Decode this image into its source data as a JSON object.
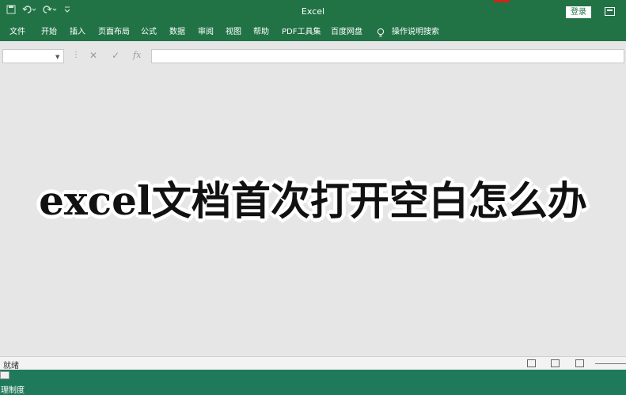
{
  "window": {
    "title": "Excel",
    "login_label": "登录"
  },
  "quick_access": {
    "icons": [
      "save-icon",
      "undo-icon",
      "redo-icon",
      "customize-icon"
    ]
  },
  "ribbon": {
    "tabs": [
      "文件",
      "开始",
      "插入",
      "页面布局",
      "公式",
      "数据",
      "审阅",
      "视图",
      "帮助",
      "PDF工具集",
      "百度网盘"
    ],
    "tell_me": "操作说明搜索"
  },
  "formula_bar": {
    "fx_label": "fx",
    "name_box_value": "",
    "formula_value": ""
  },
  "overlay": {
    "caption": "excel文档首次打开空白怎么办"
  },
  "status_bar": {
    "status": "就绪"
  },
  "desktop": {
    "icon_label": "理制度"
  },
  "colors": {
    "excel_green": "#217346",
    "workspace": "#e6e6e6",
    "taskbar": "#1f7a5c"
  }
}
